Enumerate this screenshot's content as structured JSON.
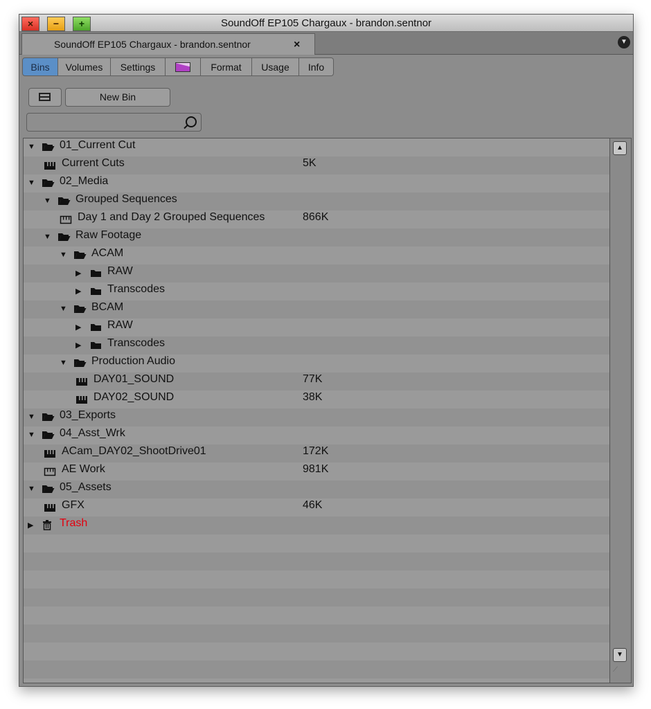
{
  "window": {
    "title": "SoundOff EP105 Chargaux - brandon.sentnor"
  },
  "doc_tab": {
    "label": "SoundOff EP105 Chargaux - brandon.sentnor",
    "close": "×"
  },
  "tabs": [
    "Bins",
    "Volumes",
    "Settings",
    "",
    "Format",
    "Usage",
    "Info"
  ],
  "active_tab": "Bins",
  "toolbar": {
    "new_bin": "New Bin"
  },
  "search": {
    "value": "",
    "placeholder": ""
  },
  "tree": [
    {
      "label": "01_Current Cut",
      "size": "",
      "kind": "folder",
      "expanded": true,
      "depth": 0
    },
    {
      "label": "Current Cuts",
      "size": "5K",
      "kind": "bin-filled",
      "depth": 1
    },
    {
      "label": "02_Media",
      "size": "",
      "kind": "folder",
      "expanded": true,
      "depth": 0
    },
    {
      "label": "Grouped Sequences",
      "size": "",
      "kind": "folder",
      "expanded": true,
      "depth": 1
    },
    {
      "label": "Day 1 and Day 2 Grouped Sequences",
      "size": "866K",
      "kind": "bin-empty",
      "depth": 2
    },
    {
      "label": "Raw Footage",
      "size": "",
      "kind": "folder",
      "expanded": true,
      "depth": 1
    },
    {
      "label": "ACAM",
      "size": "",
      "kind": "folder",
      "expanded": true,
      "depth": 2
    },
    {
      "label": "RAW",
      "size": "",
      "kind": "folder",
      "expanded": false,
      "depth": 3
    },
    {
      "label": "Transcodes",
      "size": "",
      "kind": "folder",
      "expanded": false,
      "depth": 3
    },
    {
      "label": "BCAM",
      "size": "",
      "kind": "folder",
      "expanded": true,
      "depth": 2
    },
    {
      "label": "RAW",
      "size": "",
      "kind": "folder",
      "expanded": false,
      "depth": 3
    },
    {
      "label": "Transcodes",
      "size": "",
      "kind": "folder",
      "expanded": false,
      "depth": 3
    },
    {
      "label": "Production Audio",
      "size": "",
      "kind": "folder",
      "expanded": true,
      "depth": 2
    },
    {
      "label": "DAY01_SOUND",
      "size": "77K",
      "kind": "bin-filled",
      "depth": 3
    },
    {
      "label": "DAY02_SOUND",
      "size": "38K",
      "kind": "bin-filled",
      "depth": 3
    },
    {
      "label": "03_Exports",
      "size": "",
      "kind": "folder",
      "expanded": true,
      "depth": 0
    },
    {
      "label": "04_Asst_Wrk",
      "size": "",
      "kind": "folder",
      "expanded": true,
      "depth": 0
    },
    {
      "label": "ACam_DAY02_ShootDrive01",
      "size": "172K",
      "kind": "bin-filled",
      "depth": 1
    },
    {
      "label": "AE Work",
      "size": "981K",
      "kind": "bin-empty",
      "depth": 1
    },
    {
      "label": "05_Assets",
      "size": "",
      "kind": "folder",
      "expanded": true,
      "depth": 0
    },
    {
      "label": "GFX",
      "size": "46K",
      "kind": "bin-filled",
      "depth": 1
    },
    {
      "label": "Trash",
      "size": "",
      "kind": "trash",
      "expanded": false,
      "depth": 0
    }
  ],
  "colors": {
    "active_tab": "#5b8fc7",
    "trash_label": "#e3000f",
    "pane_row_a": "#9a9a9a",
    "pane_row_b": "#929292"
  }
}
